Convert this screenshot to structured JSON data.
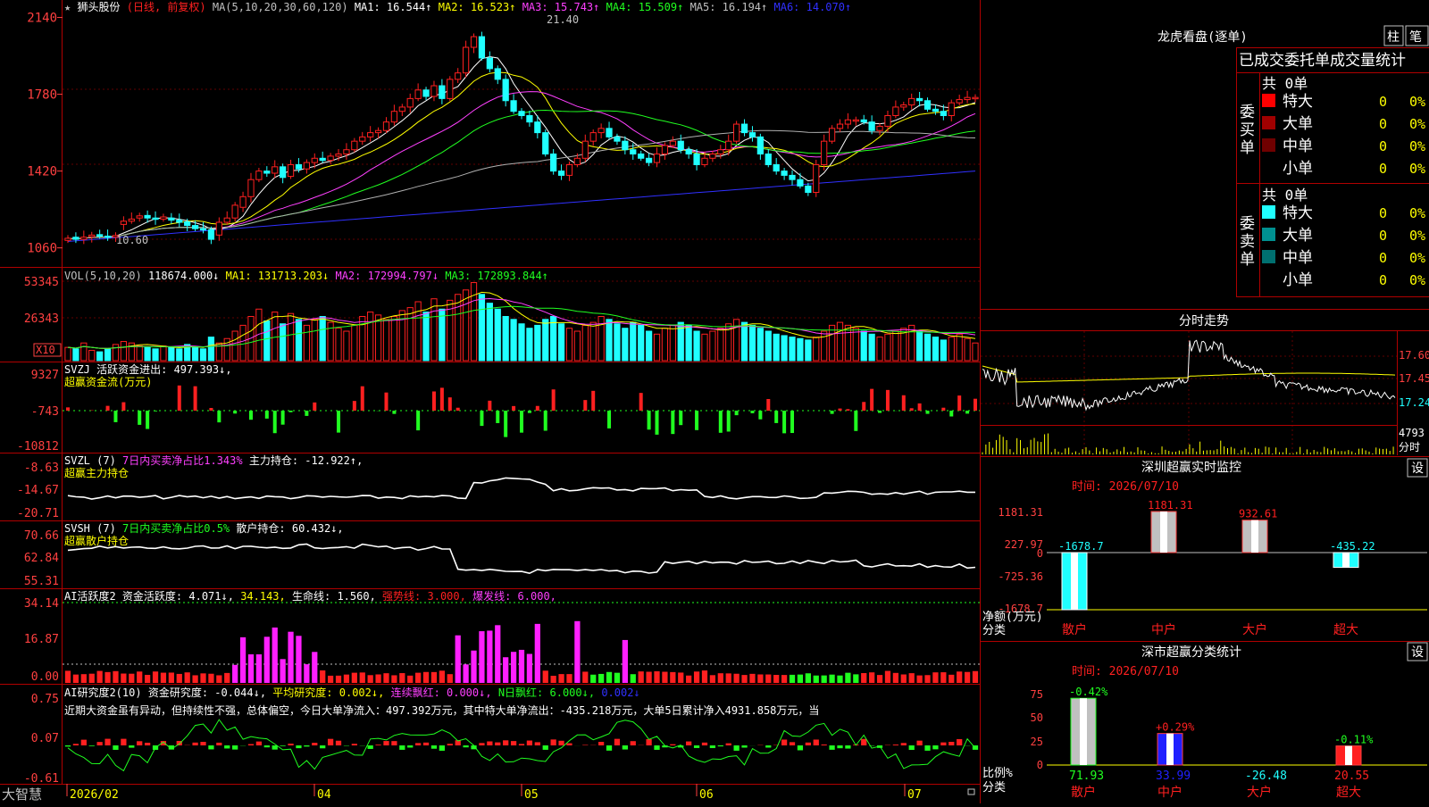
{
  "app": {
    "name": "大智慧"
  },
  "colors": {
    "up": "#ff2020",
    "down": "#20ffff",
    "ma1": "#ffffff",
    "ma2": "#ffff00",
    "ma3": "#ff40ff",
    "ma4": "#20ff20",
    "ma5": "#b0b0b0",
    "ma6": "#3030ff",
    "grid": "#b00000",
    "text": "#c0c0c0"
  },
  "main_header": {
    "star": "★",
    "stock_name": "狮头股份",
    "period": "(日线, 前复权)",
    "ma_params": "MA(5,10,20,30,60,120)",
    "ma": [
      {
        "label": "MA1: 16.544↑",
        "color": "#ffffff"
      },
      {
        "label": "MA2: 16.523↑",
        "color": "#ffff00"
      },
      {
        "label": "MA3: 15.743↑",
        "color": "#ff40ff"
      },
      {
        "label": "MA4: 15.509↑",
        "color": "#20ff20"
      },
      {
        "label": "MA5: 16.194↑",
        "color": "#c0c0c0"
      },
      {
        "label": "MA6: 14.070↑",
        "color": "#3030ff"
      }
    ],
    "high_marker": "21.40",
    "low_marker": "10.60"
  },
  "price_axis": [
    "2140",
    "1780",
    "1420",
    "1060"
  ],
  "vol_header": {
    "params": "VOL(5,10,20)",
    "value": "118674.000↓",
    "ma1": "MA1: 131713.203↓",
    "ma2": "MA2: 172994.797↓",
    "ma3": "MA3: 172893.844↑"
  },
  "vol_axis": [
    "53345",
    "26343"
  ],
  "vol_unit": "X10",
  "svzj": {
    "header": "SVZJ  活跃资金进出: 497.393↓,",
    "sub": "超赢资金流(万元)",
    "axis": [
      "9327",
      "-743",
      "-10812"
    ]
  },
  "svzl": {
    "name": "SVZL (7)",
    "desc": "7日内买卖净占比1.343%",
    "value": "主力持仓: -12.922↑,",
    "sub": "超赢主力持仓",
    "axis": [
      "-8.63",
      "-14.67",
      "-20.71"
    ]
  },
  "svsh": {
    "name": "SVSH (7)",
    "desc": "7日内买卖净占比0.5%",
    "value": "散户持仓: 60.432↓,",
    "sub": "超赢散户持仓",
    "axis": [
      "70.66",
      "62.84",
      "55.31"
    ]
  },
  "ai1": {
    "name": "AI活跃度2",
    "v1": "资金活跃度: 4.071↓,",
    "v2": "34.143,",
    "v3": "生命线: 1.560,",
    "v4": "强势线: 3.000,",
    "v5": "爆发线: 6.000,",
    "axis": [
      "34.14",
      "16.87",
      "0.00"
    ]
  },
  "ai2": {
    "name": "AI研究度2(10)",
    "v1": "资金研究度: -0.044↓,",
    "v2": "平均研究度: 0.002↓,",
    "v3": "连续飘红: 0.000↓,",
    "v4": "N日飘红: 6.000↓,",
    "v5": "0.002↓",
    "comment": "近期大资金虽有异动，但持续性不强，总体偏空，今日大单净流入：497.392万元，其中特大单净流出：-435.218万元，大单5日累计净入4931.858万元，当",
    "axis": [
      "0.75",
      "0.07",
      "-0.61"
    ]
  },
  "date_axis": [
    "2026/02",
    "04",
    "05",
    "06",
    "07"
  ],
  "right": {
    "lhb": {
      "title": "龙虎看盘(逐单)",
      "btn1": "柱",
      "btn2": "笔",
      "subtitle": "已成交委托单成交量统计",
      "buy": {
        "label": "委买单",
        "total": "共 0单",
        "rows": [
          {
            "name": "特大",
            "count": "0",
            "pct": "0%",
            "color": "#ff0000"
          },
          {
            "name": "大单",
            "count": "0",
            "pct": "0%",
            "color": "#a00000"
          },
          {
            "name": "中单",
            "count": "0",
            "pct": "0%",
            "color": "#700000"
          },
          {
            "name": "小单",
            "count": "0",
            "pct": "0%",
            "color": "#000000"
          }
        ]
      },
      "sell": {
        "label": "委卖单",
        "total": "共 0单",
        "rows": [
          {
            "name": "特大",
            "count": "0",
            "pct": "0%",
            "color": "#20ffff"
          },
          {
            "name": "大单",
            "count": "0",
            "pct": "0%",
            "color": "#009090"
          },
          {
            "name": "中单",
            "count": "0",
            "pct": "0%",
            "color": "#007070"
          },
          {
            "name": "小单",
            "count": "0",
            "pct": "0%",
            "color": "#000000"
          }
        ]
      }
    },
    "intraday": {
      "title": "分时走势",
      "axis": [
        "17.60",
        "17.45",
        "17.24"
      ],
      "vol_value": "4793",
      "vol_label": "分时"
    },
    "monitor": {
      "title": "深圳超赢实时监控",
      "btn": "设",
      "time": "时间: 2026/07/10",
      "y_label": "净额(万元)",
      "x_title": "分类",
      "axis": [
        "1181.31",
        "227.97",
        "0",
        "-725.36",
        "-1678.7"
      ],
      "categories": [
        "散户",
        "中户",
        "大户",
        "超大"
      ],
      "bar_labels": [
        "-1678.7",
        "1181.31",
        "932.61",
        "-435.22"
      ]
    },
    "classify": {
      "title": "深市超赢分类统计",
      "btn": "设",
      "time": "时间: 2026/07/10",
      "y_label": "比例%",
      "x_title": "分类",
      "axis": [
        "75",
        "50",
        "25",
        "0"
      ],
      "categories": [
        "散户",
        "中户",
        "大户",
        "超大"
      ],
      "top_labels": [
        "-0.42%",
        "+0.29%",
        "",
        "-0.11%"
      ],
      "bottom_labels": [
        "71.93",
        "33.99",
        "-26.48",
        "20.55"
      ]
    }
  },
  "chart_data": [
    {
      "type": "candlestick",
      "title": "狮头股份 日线",
      "price_unit": "axis label ×100",
      "x_dates": [
        "2026/02",
        "04",
        "05",
        "06",
        "07"
      ],
      "ylim": [
        1000,
        2180
      ],
      "close": [
        1105,
        1100,
        1110,
        1120,
        1115,
        1110,
        1118,
        1185,
        1195,
        1210,
        1200,
        1195,
        1205,
        1190,
        1180,
        1165,
        1150,
        1145,
        1100,
        1180,
        1200,
        1260,
        1300,
        1380,
        1420,
        1410,
        1440,
        1390,
        1450,
        1430,
        1460,
        1480,
        1470,
        1490,
        1500,
        1520,
        1560,
        1580,
        1600,
        1610,
        1650,
        1700,
        1720,
        1760,
        1800,
        1770,
        1820,
        1760,
        1850,
        1880,
        2000,
        2050,
        1950,
        1900,
        1850,
        1750,
        1700,
        1680,
        1650,
        1600,
        1500,
        1420,
        1400,
        1450,
        1480,
        1560,
        1600,
        1620,
        1580,
        1560,
        1520,
        1500,
        1480,
        1460,
        1500,
        1540,
        1560,
        1520,
        1500,
        1450,
        1480,
        1500,
        1520,
        1560,
        1640,
        1600,
        1580,
        1500,
        1450,
        1420,
        1400,
        1380,
        1350,
        1320,
        1450,
        1560,
        1620,
        1640,
        1660,
        1660,
        1650,
        1610,
        1630,
        1680,
        1720,
        1730,
        1760,
        1750,
        1710,
        1700,
        1680,
        1740,
        1755,
        1765,
        1765
      ],
      "open": [
        1095,
        1110,
        1100,
        1112,
        1122,
        1115,
        1110,
        1170,
        1185,
        1200,
        1212,
        1200,
        1195,
        1200,
        1190,
        1182,
        1165,
        1150,
        1145,
        1120,
        1180,
        1200,
        1250,
        1300,
        1380,
        1420,
        1410,
        1440,
        1395,
        1450,
        1430,
        1460,
        1480,
        1470,
        1490,
        1500,
        1520,
        1560,
        1580,
        1600,
        1610,
        1650,
        1700,
        1720,
        1760,
        1800,
        1770,
        1820,
        1760,
        1850,
        1880,
        2000,
        2050,
        1950,
        1900,
        1850,
        1750,
        1700,
        1680,
        1650,
        1600,
        1500,
        1420,
        1400,
        1450,
        1480,
        1560,
        1600,
        1620,
        1580,
        1560,
        1520,
        1500,
        1480,
        1460,
        1500,
        1540,
        1560,
        1520,
        1500,
        1450,
        1480,
        1500,
        1520,
        1560,
        1640,
        1600,
        1580,
        1500,
        1450,
        1420,
        1400,
        1380,
        1350,
        1320,
        1450,
        1560,
        1620,
        1640,
        1660,
        1660,
        1650,
        1610,
        1630,
        1680,
        1720,
        1730,
        1760,
        1750,
        1710,
        1700,
        1680,
        1740,
        1755,
        1765
      ],
      "ma_values": {
        "MA1": 16.544,
        "MA2": 16.523,
        "MA3": 15.743,
        "MA4": 15.509,
        "MA5": 16.194,
        "MA6": 14.07
      }
    },
    {
      "type": "bar",
      "title": "VOL(5,10,20)",
      "unit": "X10",
      "ylim": [
        0,
        60000
      ],
      "values": [
        9000,
        8000,
        12000,
        7000,
        6000,
        8000,
        11000,
        13000,
        12000,
        10000,
        9000,
        8000,
        10000,
        9000,
        8000,
        11000,
        9000,
        8000,
        16000,
        12000,
        15000,
        20000,
        24000,
        30000,
        35000,
        27000,
        33000,
        25000,
        32000,
        28000,
        24000,
        28000,
        30000,
        26000,
        22000,
        20000,
        24000,
        30000,
        33000,
        31000,
        28000,
        30000,
        34000,
        36000,
        40000,
        33000,
        42000,
        35000,
        41000,
        45000,
        48000,
        53000,
        45000,
        39000,
        35000,
        30000,
        28000,
        25000,
        22000,
        24000,
        28000,
        30000,
        25000,
        22000,
        20000,
        24000,
        26000,
        30000,
        28000,
        25000,
        22000,
        26000,
        24000,
        20000,
        18000,
        22000,
        24000,
        26000,
        24000,
        20000,
        18000,
        20000,
        22000,
        25000,
        28000,
        26000,
        24000,
        22000,
        20000,
        18000,
        17000,
        16000,
        15000,
        14000,
        16000,
        20000,
        24000,
        26000,
        24000,
        22000,
        20000,
        18000,
        16000,
        18000,
        20000,
        22000,
        24000,
        20000,
        18000,
        16000,
        14000,
        16000,
        18000,
        15000,
        12000
      ]
    },
    {
      "type": "bar",
      "title": "SVZJ 超赢资金流(万元)",
      "ylim": [
        -10812,
        9327
      ],
      "latest": 497.393
    },
    {
      "type": "line",
      "title": "SVZL (7) 超赢主力持仓",
      "ylim": [
        -20.71,
        -8.63
      ],
      "latest": -12.922
    },
    {
      "type": "line",
      "title": "SVSH (7) 超赢散户持仓",
      "ylim": [
        55.31,
        70.66
      ],
      "latest": 60.432
    },
    {
      "type": "bar",
      "title": "AI活跃度2",
      "ylim": [
        0,
        34.14
      ],
      "latest": 4.071
    },
    {
      "type": "bar",
      "title": "AI研究度2(10)",
      "ylim": [
        -0.61,
        0.75
      ],
      "latest": -0.044
    },
    {
      "type": "bar",
      "title": "深圳超赢实时监控",
      "categories": [
        "散户",
        "中户",
        "大户",
        "超大"
      ],
      "values": [
        -1678.7,
        1181.31,
        932.61,
        -435.22
      ],
      "ylabel": "净额(万元)",
      "ylim": [
        -1678.7,
        1181.31
      ]
    },
    {
      "type": "bar",
      "title": "深市超赢分类统计",
      "categories": [
        "散户",
        "中户",
        "大户",
        "超大"
      ],
      "values": [
        71.93,
        33.99,
        -26.48,
        20.55
      ],
      "changes": [
        "-0.42%",
        "+0.29%",
        "",
        "-0.11%"
      ],
      "ylabel": "比例%",
      "ylim": [
        0,
        75
      ]
    }
  ]
}
